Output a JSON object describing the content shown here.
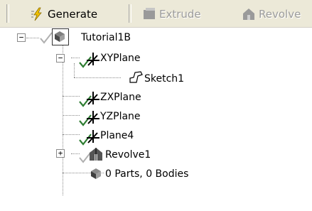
{
  "toolbar": {
    "generate_label": "Generate",
    "extrude_label": "Extrude",
    "revolve_label": "Revolve"
  },
  "tree": {
    "root_label": "Tutorial1B",
    "xyplane_label": "XYPlane",
    "sketch_label": "Sketch1",
    "zxplane_label": "ZXPlane",
    "yzplane_label": "YZPlane",
    "plane4_label": "Plane4",
    "revolve_label": "Revolve1",
    "parts_label": "0 Parts, 0 Bodies"
  },
  "colors": {
    "toolbar_bg": "#ece9d8",
    "check_green": "#2e7d32",
    "disabled_text": "#9c9c9c"
  }
}
